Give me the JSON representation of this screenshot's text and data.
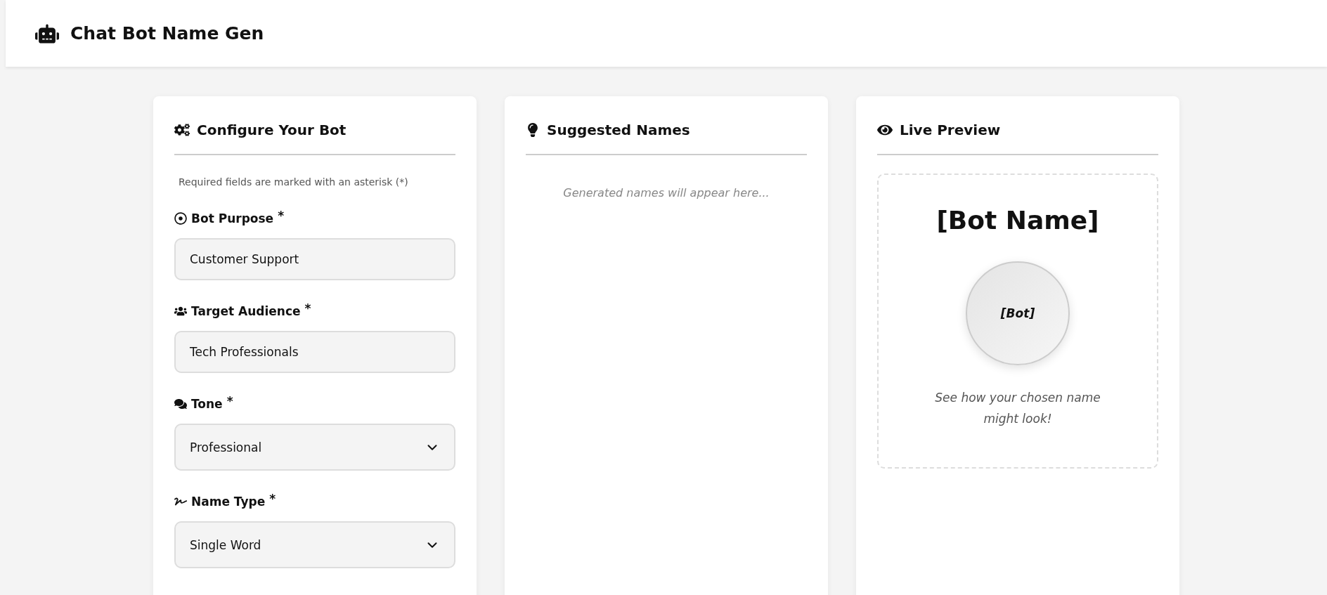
{
  "header": {
    "title": "Chat Bot Name Gen"
  },
  "config": {
    "title": "Configure Your Bot",
    "note": "Required fields are marked with an asterisk (*)",
    "fields": [
      {
        "kind": "input",
        "label": "Bot Purpose",
        "mark": "*",
        "value": "Customer Support"
      },
      {
        "kind": "input",
        "label": "Target Audience",
        "mark": "*",
        "value": "Tech Professionals"
      },
      {
        "kind": "select",
        "label": "Tone",
        "mark": "*",
        "value": "Professional"
      },
      {
        "kind": "select",
        "label": "Name Type",
        "mark": "*",
        "value": "Single Word"
      }
    ]
  },
  "suggestions": {
    "title": "Suggested Names",
    "empty": "Generated names will appear here..."
  },
  "preview": {
    "title": "Live Preview",
    "name": "[Bot Name]",
    "avatar": "[Bot]",
    "caption": "See how your chosen name might look!"
  }
}
